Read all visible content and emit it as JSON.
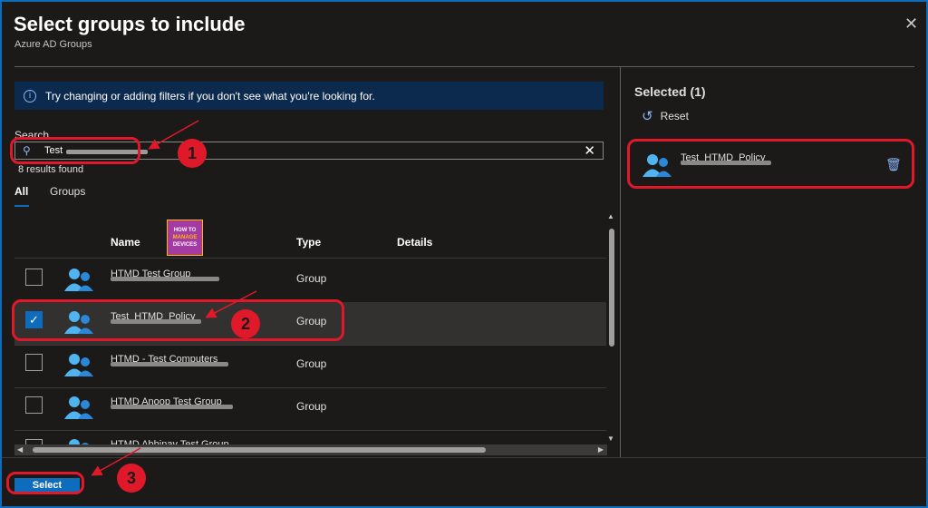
{
  "dialog": {
    "title": "Select groups to include",
    "subtitle": "Azure AD Groups",
    "close_icon": "close-icon"
  },
  "info_banner": {
    "text": "Try changing or adding filters if you don't see what you're looking for.",
    "icon": "info-icon"
  },
  "search": {
    "label": "Search",
    "value": "Test ",
    "icon": "search-icon",
    "clear_icon": "clear-icon",
    "results_text": "8 results found"
  },
  "tabs": [
    {
      "label": "All",
      "active": true
    },
    {
      "label": "Groups",
      "active": false
    }
  ],
  "table": {
    "columns": {
      "name": "Name",
      "type": "Type",
      "details": "Details"
    },
    "logo": {
      "line1": "HOW TO",
      "line2": "MANAGE",
      "line3": "DEVICES"
    },
    "rows": [
      {
        "name": "HTMD Test Group",
        "type": "Group",
        "checked": false
      },
      {
        "name": "Test_HTMD_Policy",
        "type": "Group",
        "checked": true
      },
      {
        "name": "HTMD - Test Computers",
        "type": "Group",
        "checked": false
      },
      {
        "name": "HTMD Anoop Test Group",
        "type": "Group",
        "checked": false
      },
      {
        "name": "HTMD Abhinav Test Group",
        "type": "Group",
        "checked": false
      }
    ]
  },
  "selected_panel": {
    "title": "Selected (1)",
    "reset_label": "Reset",
    "items": [
      {
        "name": "Test_HTMD_Policy"
      }
    ]
  },
  "footer": {
    "select_label": "Select"
  },
  "annotations": {
    "badges": [
      "1",
      "2",
      "3"
    ]
  },
  "colors": {
    "accent": "#0f6cbd",
    "background": "#1b1a19",
    "annotation": "#e0192a"
  }
}
